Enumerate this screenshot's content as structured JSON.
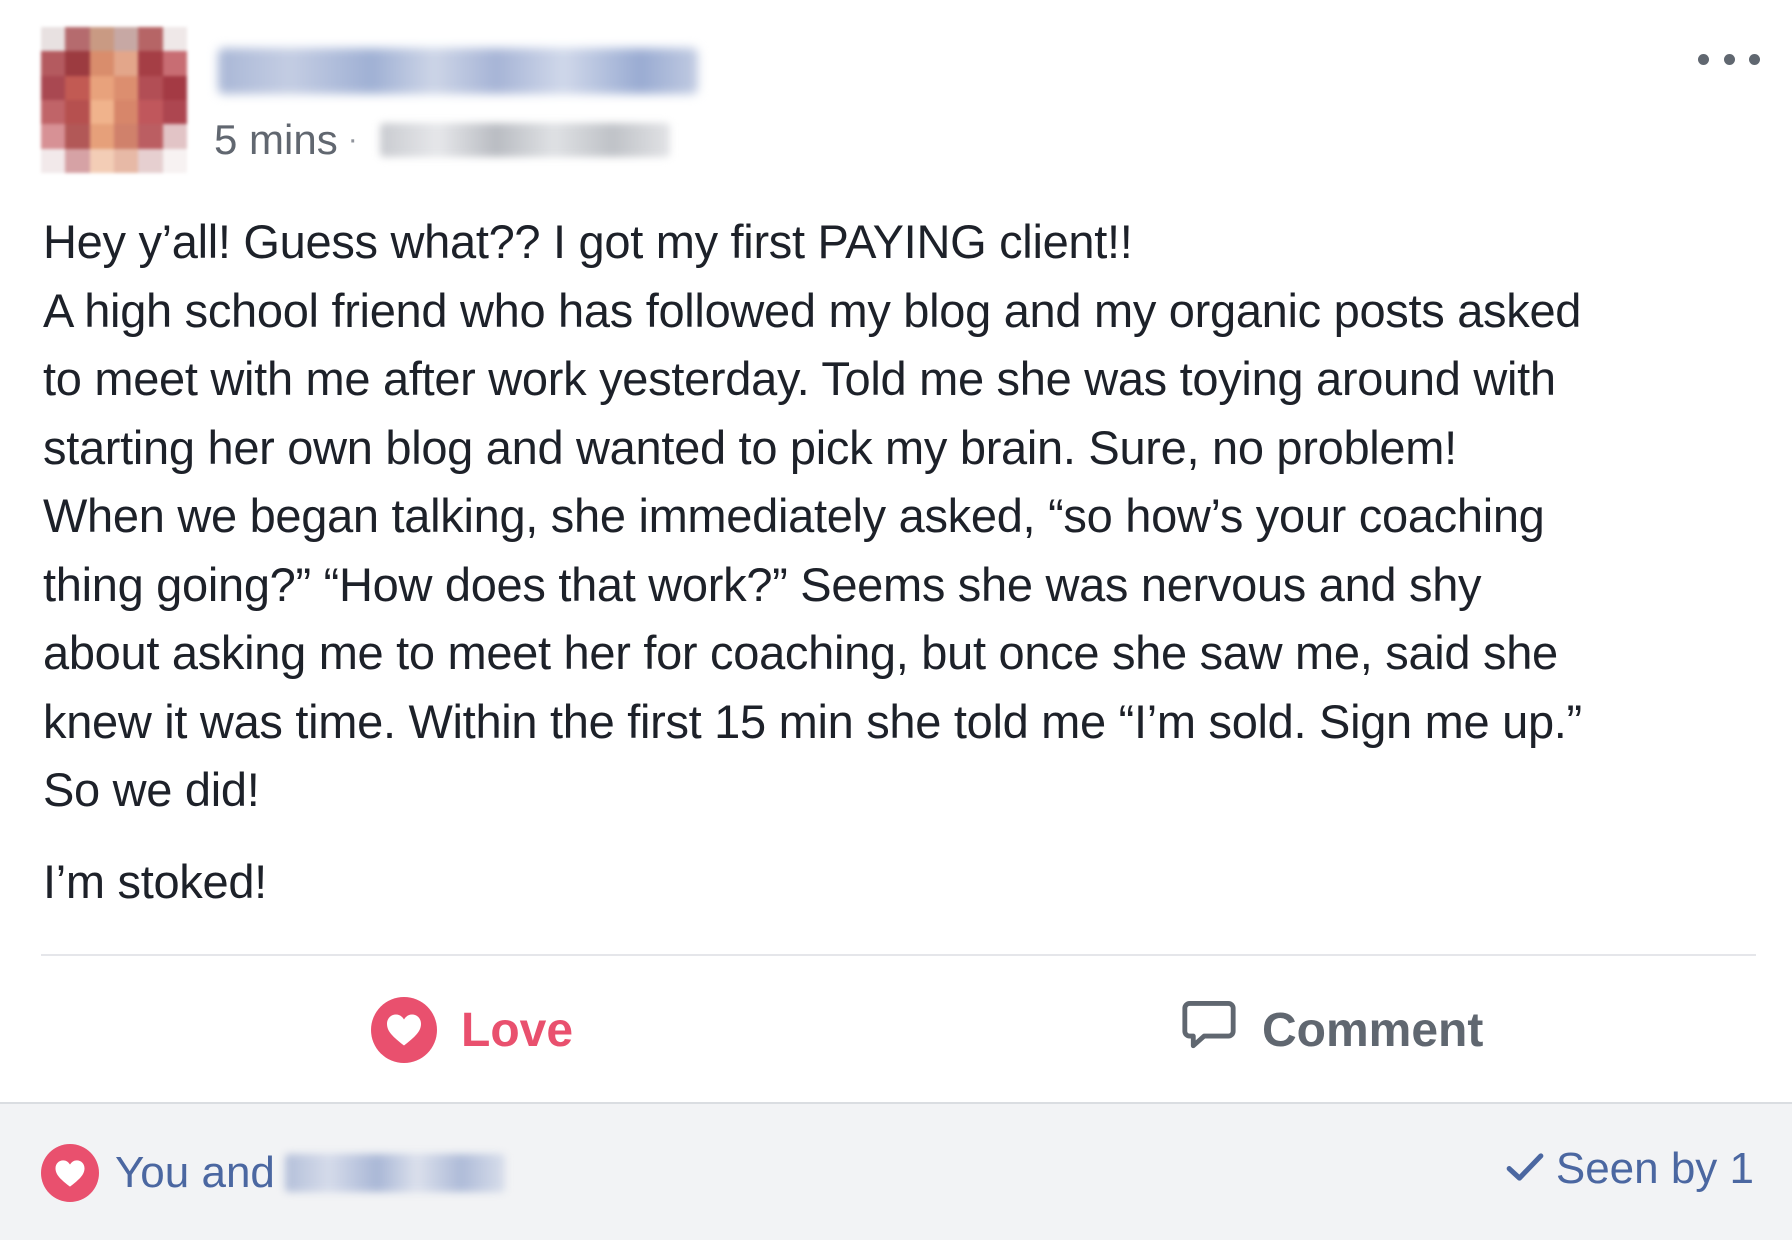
{
  "post": {
    "timestamp": "5 mins",
    "separator": "·",
    "lines": [
      "Hey y’all! Guess what?? I got my first PAYING client!!",
      "A high school friend who has followed my blog and my organic posts asked",
      "to meet with me after work yesterday. Told me she was toying around with",
      "starting her own blog and wanted to pick my brain. Sure, no problem!",
      "When we began talking, she immediately asked, “so how’s your coaching",
      "thing going?” “How does that work?” Seems she was nervous and shy",
      "about asking me to meet her for coaching, but once she saw me, said she",
      "knew it was time. Within the first 15 min she told me “I’m sold. Sign me up.”",
      "So we did!"
    ],
    "closing": "I’m stoked!"
  },
  "actions": {
    "love_label": "Love",
    "comment_label": "Comment"
  },
  "footer": {
    "reaction_prefix": "You and",
    "seen_label": "Seen by 1"
  },
  "icons": {
    "more": "more-options-icon",
    "love": "heart-icon",
    "comment": "comment-bubble-icon",
    "check": "checkmark-icon"
  },
  "colors": {
    "love": "#e9506e",
    "link": "#4b67a1",
    "muted": "#616770",
    "footer_bg": "#f2f3f5"
  }
}
